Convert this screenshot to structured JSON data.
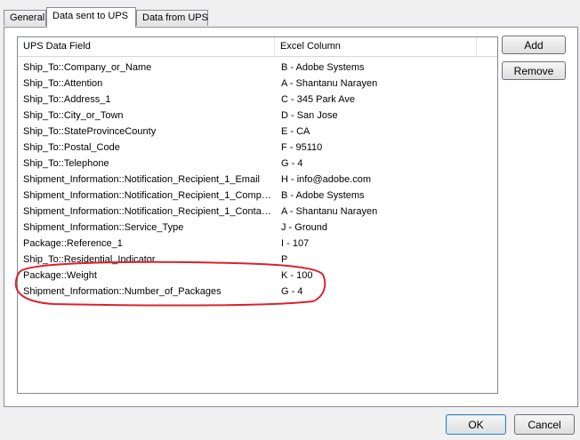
{
  "tabs": [
    {
      "label": "General"
    },
    {
      "label": "Data sent to UPS"
    },
    {
      "label": "Data from UPS"
    }
  ],
  "list": {
    "columns": [
      "UPS Data Field",
      "Excel Column"
    ],
    "rows": [
      [
        "Ship_To::Company_or_Name",
        "B - Adobe Systems"
      ],
      [
        "Ship_To::Attention",
        "A - Shantanu Narayen"
      ],
      [
        "Ship_To::Address_1",
        "C - 345 Park Ave"
      ],
      [
        "Ship_To::City_or_Town",
        "D - San Jose"
      ],
      [
        "Ship_To::StateProvinceCounty",
        "E - CA"
      ],
      [
        "Ship_To::Postal_Code",
        "F - 95110"
      ],
      [
        "Ship_To::Telephone",
        "G - 4"
      ],
      [
        "Shipment_Information::Notification_Recipient_1_Email",
        "H - info@adobe.com"
      ],
      [
        "Shipment_Information::Notification_Recipient_1_Compan...",
        "B - Adobe Systems"
      ],
      [
        "Shipment_Information::Notification_Recipient_1_Contact...",
        "A - Shantanu Narayen"
      ],
      [
        "Shipment_Information::Service_Type",
        "J - Ground"
      ],
      [
        "Package::Reference_1",
        "I - 107"
      ],
      [
        "Ship_To::Residential_Indicator",
        "P"
      ],
      [
        "Package::Weight",
        "K - 100"
      ],
      [
        "Shipment_Information::Number_of_Packages",
        "G - 4"
      ]
    ]
  },
  "buttons": {
    "add": "Add",
    "remove": "Remove",
    "ok": "OK",
    "cancel": "Cancel"
  },
  "colors": {
    "annotation": "#d9232d"
  }
}
